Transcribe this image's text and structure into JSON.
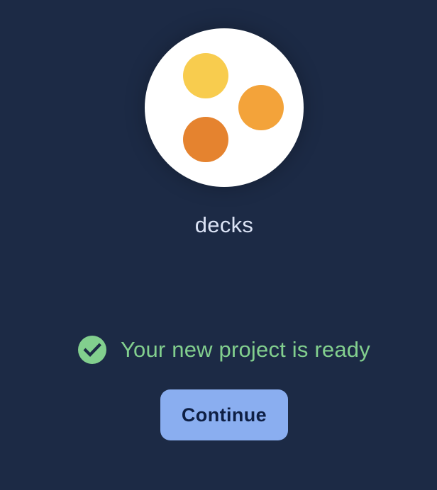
{
  "project": {
    "name": "decks",
    "logo": {
      "icon": "decks-logo-icon",
      "dot_colors": [
        "#f8cc4e",
        "#f3a33a",
        "#e5832f"
      ]
    }
  },
  "status": {
    "icon": "check-circle-icon",
    "text": "Your new project is ready",
    "color": "#82cf8e"
  },
  "actions": {
    "continue_label": "Continue"
  },
  "colors": {
    "background": "#1c2a45",
    "button": "#8aaef0"
  }
}
